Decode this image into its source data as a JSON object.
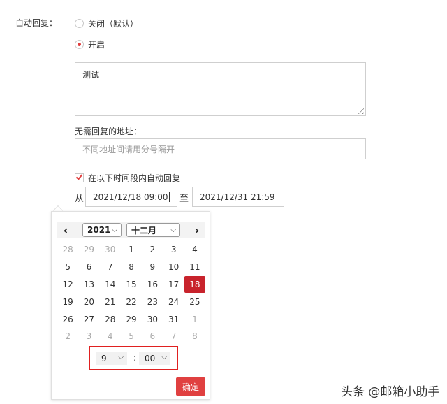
{
  "auto_reply": {
    "label": "自动回复：",
    "option_off": "关闭（默认）",
    "option_on": "开启",
    "selected": "on",
    "message": "测试"
  },
  "no_reply": {
    "label": "无需回复的地址：",
    "placeholder": "不同地址间请用分号隔开"
  },
  "time_range": {
    "checkbox_label": "在以下时间段内自动回复",
    "checked": true,
    "from_label": "从",
    "to_label": "至",
    "from_value": "2021/12/18 09:00",
    "to_value": "2021/12/31 21:59"
  },
  "calendar": {
    "prev_icon": "chevron-left-icon",
    "next_icon": "chevron-right-icon",
    "year": "2021",
    "month": "十二月",
    "days": [
      [
        "28",
        "29",
        "30",
        "1",
        "2",
        "3",
        "4"
      ],
      [
        "5",
        "6",
        "7",
        "8",
        "9",
        "10",
        "11"
      ],
      [
        "12",
        "13",
        "14",
        "15",
        "16",
        "17",
        "18"
      ],
      [
        "19",
        "20",
        "21",
        "22",
        "23",
        "24",
        "25"
      ],
      [
        "26",
        "27",
        "28",
        "29",
        "30",
        "31",
        "1"
      ],
      [
        "2",
        "3",
        "4",
        "5",
        "6",
        "7",
        "8"
      ]
    ],
    "selected_day": "18",
    "hour": "9",
    "minute": "00",
    "confirm_label": "确定",
    "accent_color": "#c8232c",
    "highlight_border_color": "#e02020"
  },
  "watermark": "头条 @邮箱小助手"
}
